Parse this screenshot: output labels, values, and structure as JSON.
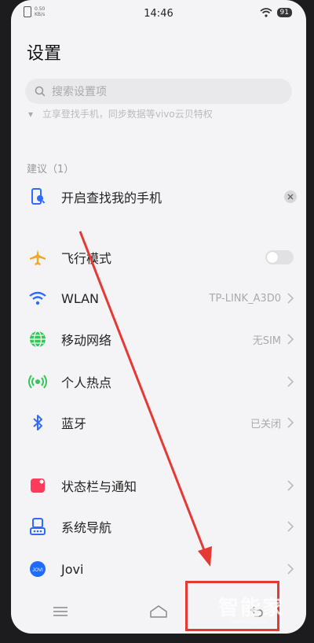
{
  "status_bar": {
    "speed": "0.50\nKB/s",
    "time": "14:46",
    "battery": "91"
  },
  "page": {
    "title": "设置"
  },
  "search": {
    "placeholder": "搜索设置项"
  },
  "promo": {
    "text": "立享登找手机，同步数据等vivo云贝特权"
  },
  "suggestions": {
    "header": "建议（1）",
    "item": {
      "label": "开启查找我的手机",
      "icon": "find-phone-icon"
    }
  },
  "settings": [
    {
      "label": "飞行模式",
      "value": "",
      "icon": "airplane-icon",
      "color": "#f5a623",
      "control": "toggle"
    },
    {
      "label": "WLAN",
      "value": "TP-LINK_A3D0",
      "icon": "wifi-icon",
      "color": "#2f6bff",
      "control": "chevron"
    },
    {
      "label": "移动网络",
      "value": "无SIM",
      "icon": "mobile-network-icon",
      "color": "#34c759",
      "control": "chevron"
    },
    {
      "label": "个人热点",
      "value": "",
      "icon": "hotspot-icon",
      "color": "#34c759",
      "control": "chevron"
    },
    {
      "label": "蓝牙",
      "value": "已关闭",
      "icon": "bluetooth-icon",
      "color": "#2f6bff",
      "control": "chevron"
    },
    {
      "label": "状态栏与通知",
      "value": "",
      "icon": "status-bar-icon",
      "color": "#ff3b5c",
      "control": "chevron"
    },
    {
      "label": "系统导航",
      "value": "",
      "icon": "system-navigation-icon",
      "color": "#2f6bff",
      "control": "chevron"
    },
    {
      "label": "Jovi",
      "value": "",
      "icon": "jovi-icon",
      "color": "#1f6bff",
      "control": "chevron"
    }
  ],
  "watermark": {
    "text": "智能家",
    "sub": "www.znj.com"
  },
  "colors": {
    "annotation_red": "#e53935",
    "accent_blue": "#2f6bff"
  }
}
